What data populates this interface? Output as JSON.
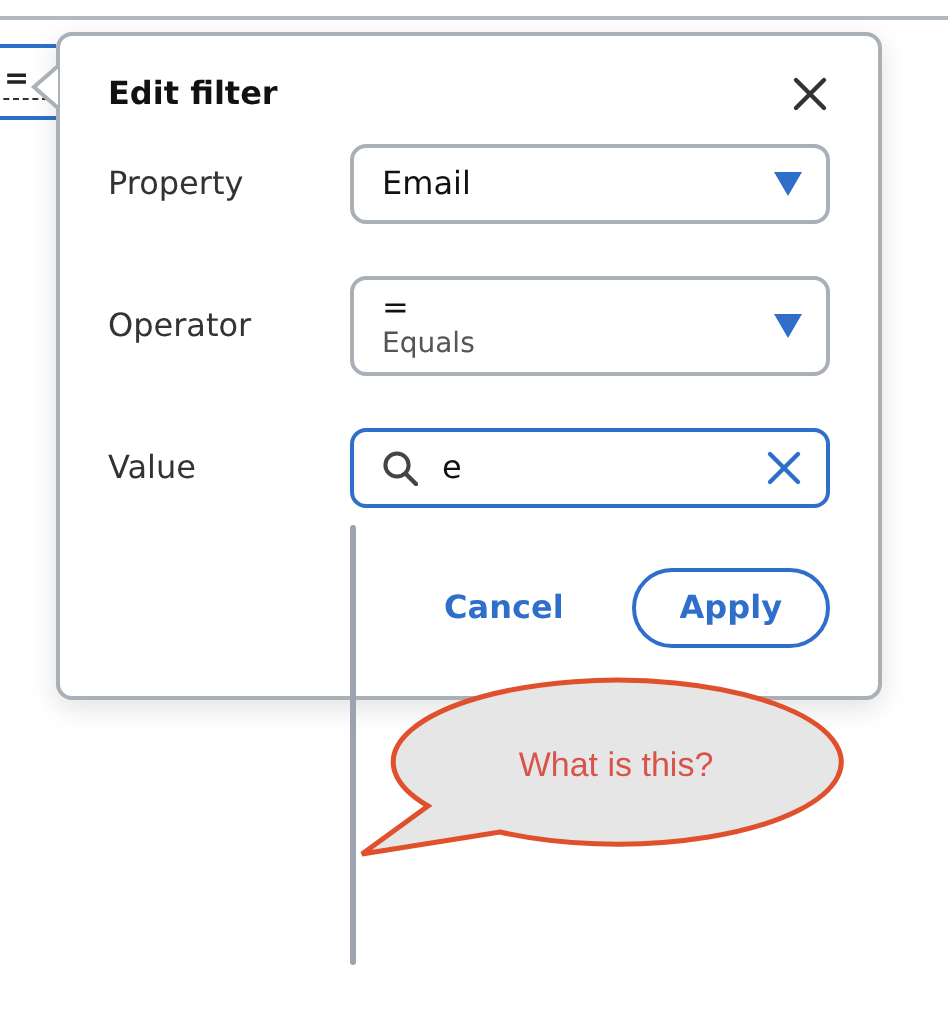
{
  "trigger": {
    "text": "="
  },
  "dialog": {
    "title": "Edit filter",
    "fields": [
      {
        "label": "Property",
        "kind": "select",
        "value": "Email"
      },
      {
        "label": "Operator",
        "kind": "select",
        "value": "=",
        "hint": "Equals"
      },
      {
        "label": "Value",
        "kind": "search",
        "value": "e",
        "focused": true
      }
    ],
    "buttons": [
      {
        "label": "Cancel",
        "kind": "link"
      },
      {
        "label": "Apply",
        "kind": "outline"
      }
    ]
  },
  "annotation": {
    "text": "What is this?"
  }
}
